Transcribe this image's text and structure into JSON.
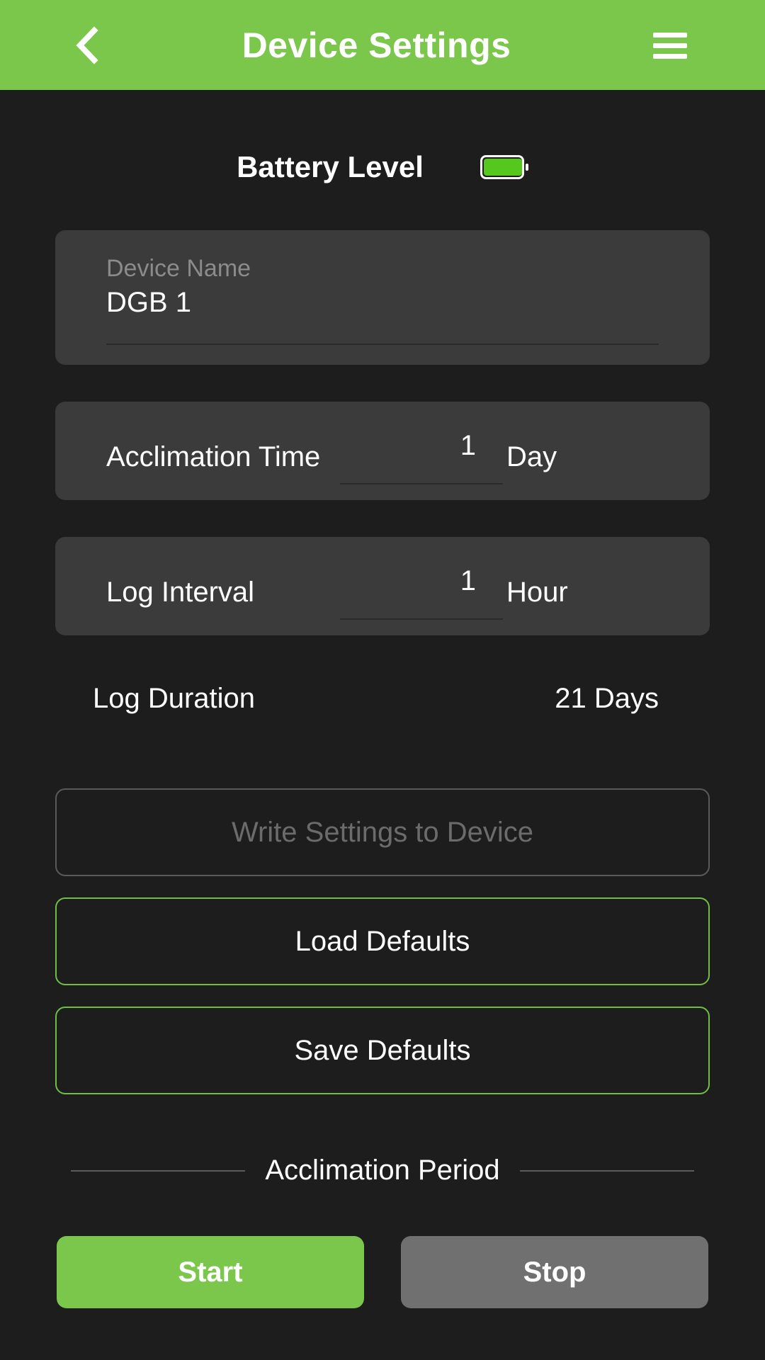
{
  "header": {
    "title": "Device Settings"
  },
  "battery": {
    "label": "Battery Level"
  },
  "device_name": {
    "label": "Device Name",
    "value": "DGB 1"
  },
  "acclimation_time": {
    "label": "Acclimation Time",
    "value": "1",
    "unit": "Day"
  },
  "log_interval": {
    "label": "Log Interval",
    "value": "1",
    "unit": "Hour"
  },
  "log_duration": {
    "label": "Log Duration",
    "value": "21 Days"
  },
  "buttons": {
    "write": "Write Settings to Device",
    "load_defaults": "Load Defaults",
    "save_defaults": "Save Defaults"
  },
  "acclimation_period": {
    "title": "Acclimation Period",
    "start": "Start",
    "stop": "Stop"
  }
}
